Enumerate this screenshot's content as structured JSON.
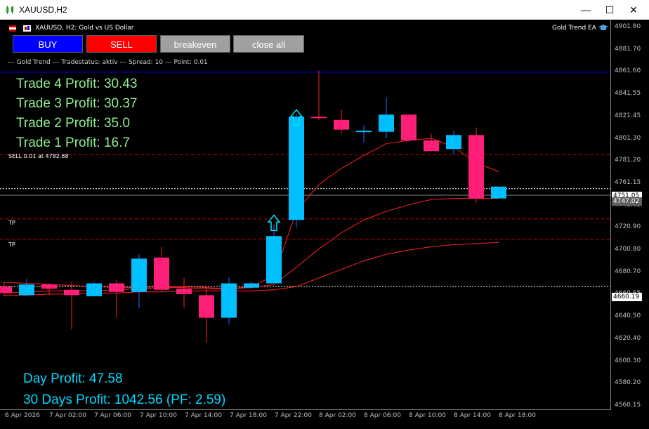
{
  "window": {
    "title": "XAUUSD,H2",
    "minimize_glyph": "—",
    "maximize_glyph": "☐",
    "close_glyph": "✕",
    "icon": "candlestick-chart-icon"
  },
  "chart_header": {
    "symbol_text": "XAUUSD, H2:  Gold vs US Dollar",
    "ea_name": "Gold Trend EA",
    "ea_icon": "graduation-cap-icon"
  },
  "buttons": {
    "buy": "BUY",
    "sell": "SELL",
    "breakeven": "breakeven",
    "close_all": "close all"
  },
  "colors": {
    "buy": "#0000ff",
    "sell": "#ff0000",
    "grey_button": "#a0a0a0",
    "bull_candle": "#00bfff",
    "bear_candle": "#ff1e78",
    "ma_line": "#ff2020",
    "profit_green": "#90ee90",
    "profit_blue": "#00d8ff"
  },
  "status_line": "--- Gold Trend --- Tradestatus: aktiv --- Spread: 10 --- Point: 0.01",
  "trade_profits": [
    {
      "label": "Trade 4 Profit: 30.43"
    },
    {
      "label": "Trade 3 Profit: 30.37"
    },
    {
      "label": "Trade 2 Profit: 35.0"
    },
    {
      "label": "Trade 1 Profit: 16.7"
    }
  ],
  "sell_label": "SELL 0.01 at 4782.68",
  "tp_labels": [
    "TP",
    "TP"
  ],
  "day_profit": "Day Profit: 47.58",
  "month_profit": "30 Days Profit: 1042.56 (PF: 2.59)",
  "price_axis": [
    "4901.80",
    "4881.70",
    "4861.60",
    "4841.55",
    "4821.45",
    "4801.30",
    "4781.20",
    "4761.15",
    "4741.05",
    "4720.90",
    "4700.80",
    "4680.70",
    "4660.65",
    "4640.50",
    "4620.40",
    "4600.30",
    "4580.20",
    "4560.15"
  ],
  "price_tags": {
    "bid": "4751.05",
    "ask": "4747.02",
    "line": "4660.19"
  },
  "time_axis": [
    "6 Apr 2026",
    "7 Apr 02:00",
    "7 Apr 06:00",
    "7 Apr 10:00",
    "7 Apr 14:00",
    "7 Apr 18:00",
    "7 Apr 22:00",
    "8 Apr 02:00",
    "8 Apr 06:00",
    "8 Apr 10:00",
    "8 Apr 14:00",
    "8 Apr 18:00"
  ],
  "chart_data": {
    "type": "candlestick",
    "ylim": [
      4560.15,
      4901.8
    ],
    "candles": [
      {
        "o": 4660,
        "h": 4664,
        "l": 4651,
        "c": 4654
      },
      {
        "o": 4652,
        "h": 4667,
        "l": 4651,
        "c": 4662
      },
      {
        "o": 4662,
        "h": 4663,
        "l": 4652,
        "c": 4658
      },
      {
        "o": 4657,
        "h": 4664,
        "l": 4620,
        "c": 4652
      },
      {
        "o": 4651,
        "h": 4664,
        "l": 4651,
        "c": 4663
      },
      {
        "o": 4663,
        "h": 4666,
        "l": 4631,
        "c": 4655
      },
      {
        "o": 4655,
        "h": 4690,
        "l": 4640,
        "c": 4686
      },
      {
        "o": 4687,
        "h": 4697,
        "l": 4655,
        "c": 4657
      },
      {
        "o": 4658,
        "h": 4668,
        "l": 4640,
        "c": 4653
      },
      {
        "o": 4652,
        "h": 4660,
        "l": 4608,
        "c": 4631
      },
      {
        "o": 4631,
        "h": 4669,
        "l": 4625,
        "c": 4663
      },
      {
        "o": 4659,
        "h": 4664,
        "l": 4658,
        "c": 4663
      },
      {
        "o": 4663,
        "h": 4718,
        "l": 4663,
        "c": 4707
      },
      {
        "o": 4722,
        "h": 4821,
        "l": 4715,
        "c": 4818
      },
      {
        "o": 4818,
        "h": 4861,
        "l": 4815,
        "c": 4817
      },
      {
        "o": 4815,
        "h": 4825,
        "l": 4802,
        "c": 4806
      },
      {
        "o": 4805,
        "h": 4810,
        "l": 4794,
        "c": 4805
      },
      {
        "o": 4804,
        "h": 4836,
        "l": 4798,
        "c": 4820
      },
      {
        "o": 4820,
        "h": 4820,
        "l": 4795,
        "c": 4796
      },
      {
        "o": 4796,
        "h": 4802,
        "l": 4786,
        "c": 4786
      },
      {
        "o": 4788,
        "h": 4805,
        "l": 4783,
        "c": 4801
      },
      {
        "o": 4801,
        "h": 4808,
        "l": 4738,
        "c": 4742
      },
      {
        "o": 4742,
        "h": 4753,
        "l": 4742,
        "c": 4753
      }
    ],
    "ma_fast": [
      4664,
      4663,
      4662,
      4661,
      4660,
      4659,
      4659,
      4660,
      4660,
      4659,
      4658,
      4660,
      4670,
      4730,
      4755,
      4770,
      4782,
      4793,
      4796,
      4798,
      4790,
      4775,
      4767
    ],
    "ma_mid": [
      4654,
      4655,
      4656,
      4656,
      4656,
      4657,
      4658,
      4659,
      4659,
      4658,
      4658,
      4659,
      4662,
      4678,
      4695,
      4710,
      4722,
      4730,
      4736,
      4741,
      4742,
      4742,
      4742
    ],
    "ma_slow": [
      4652,
      4652,
      4653,
      4653,
      4654,
      4654,
      4655,
      4655,
      4656,
      4656,
      4656,
      4656,
      4657,
      4660,
      4668,
      4676,
      4684,
      4690,
      4694,
      4697,
      4699,
      4700,
      4701
    ]
  }
}
